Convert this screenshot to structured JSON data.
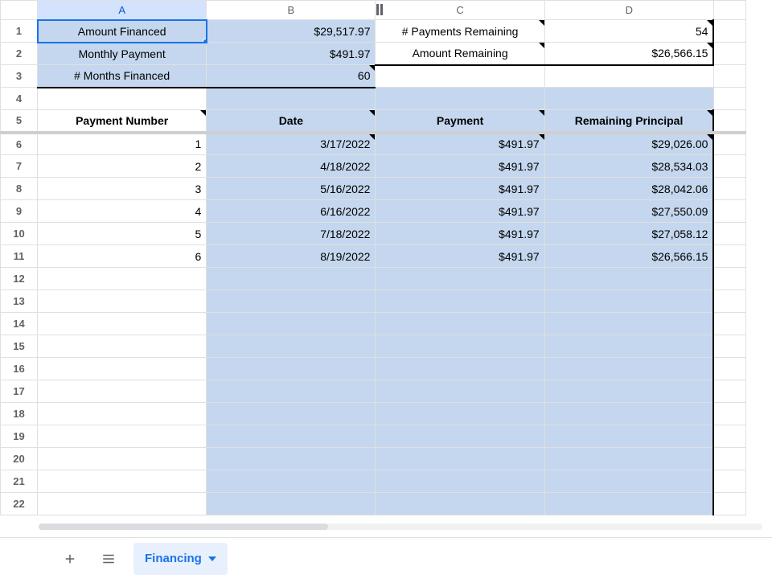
{
  "columns": [
    "A",
    "B",
    "C",
    "D"
  ],
  "summary": {
    "a1": "Amount Financed",
    "b1": "$29,517.97",
    "c1": "# Payments Remaining",
    "d1": "54",
    "a2": "Monthly Payment",
    "b2": "$491.97",
    "c2": "Amount Remaining",
    "d2": "$26,566.15",
    "a3": "# Months Financed",
    "b3": "60"
  },
  "headers": {
    "a": "Payment Number",
    "b": "Date",
    "c": "Payment",
    "d": "Remaining Principal"
  },
  "rows": [
    {
      "n": "1",
      "date": "3/17/2022",
      "pay": "$491.97",
      "rem": "$29,026.00"
    },
    {
      "n": "2",
      "date": "4/18/2022",
      "pay": "$491.97",
      "rem": "$28,534.03"
    },
    {
      "n": "3",
      "date": "5/16/2022",
      "pay": "$491.97",
      "rem": "$28,042.06"
    },
    {
      "n": "4",
      "date": "6/16/2022",
      "pay": "$491.97",
      "rem": "$27,550.09"
    },
    {
      "n": "5",
      "date": "7/18/2022",
      "pay": "$491.97",
      "rem": "$27,058.12"
    },
    {
      "n": "6",
      "date": "8/19/2022",
      "pay": "$491.97",
      "rem": "$26,566.15"
    }
  ],
  "tabs": {
    "active": "Financing"
  }
}
